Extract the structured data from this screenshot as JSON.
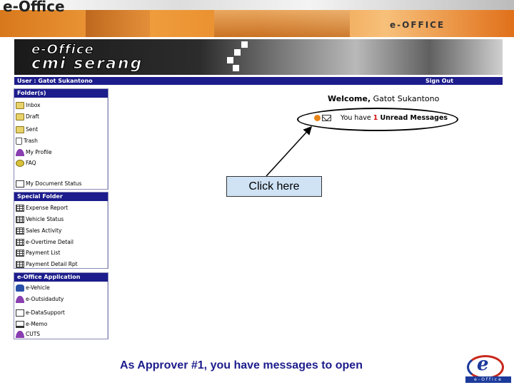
{
  "header": {
    "top_logo": "e-Office",
    "top_right_label": "e-OFFICE",
    "app_title_line1": "e-Office",
    "app_title_line2": "cmi serang"
  },
  "user_bar": {
    "user_text": "User : Gatot Sukantono",
    "sign_out": "Sign Out"
  },
  "sidebar": {
    "folders": {
      "title": "Folder(s)",
      "items": [
        {
          "label": "Inbox",
          "icon": "inbox-folder-icon"
        },
        {
          "label": "Draft",
          "icon": "draft-folder-icon"
        },
        {
          "label": "Sent",
          "icon": "sent-folder-icon"
        },
        {
          "label": "Trash",
          "icon": "trash-icon"
        },
        {
          "label": "My Profile",
          "icon": "profile-icon"
        },
        {
          "label": "FAQ",
          "icon": "faq-icon"
        },
        {
          "label": "My Document Status",
          "icon": "document-status-icon"
        }
      ]
    },
    "special": {
      "title": "Special Folder",
      "items": [
        {
          "label": "Expense Report",
          "icon": "report-grid-icon"
        },
        {
          "label": "Vehicle Status",
          "icon": "report-grid-icon"
        },
        {
          "label": "Sales Activity",
          "icon": "report-grid-icon"
        },
        {
          "label": "e-Overtime Detail",
          "icon": "report-grid-icon"
        },
        {
          "label": "Payment List",
          "icon": "report-grid-icon"
        },
        {
          "label": "Payment Detail Rpt",
          "icon": "report-grid-icon"
        }
      ]
    },
    "apps": {
      "title": "e-Office Application",
      "items": [
        {
          "label": "e-Vehicle",
          "icon": "vehicle-icon"
        },
        {
          "label": "e-Outsidaduty",
          "icon": "outside-duty-icon"
        },
        {
          "label": "e-DataSupport",
          "icon": "data-support-icon"
        },
        {
          "label": "e-Memo",
          "icon": "memo-icon"
        },
        {
          "label": "CUTS",
          "icon": "cuts-icon"
        }
      ]
    }
  },
  "main": {
    "welcome_prefix": "Welcome,",
    "welcome_name": "Gatot Sukantono",
    "message_prefix": "You have",
    "message_count": "1",
    "message_suffix": "Unread Messages",
    "callout": "Click here",
    "caption": "As Approver #1, you have messages to open"
  },
  "logo": {
    "footer_text": "e-Office"
  },
  "colors": {
    "nav_blue": "#1c1c8c",
    "callout_bg": "#cfe3f5",
    "count_red": "#d01010",
    "banner_orange": "#e88a2a"
  }
}
